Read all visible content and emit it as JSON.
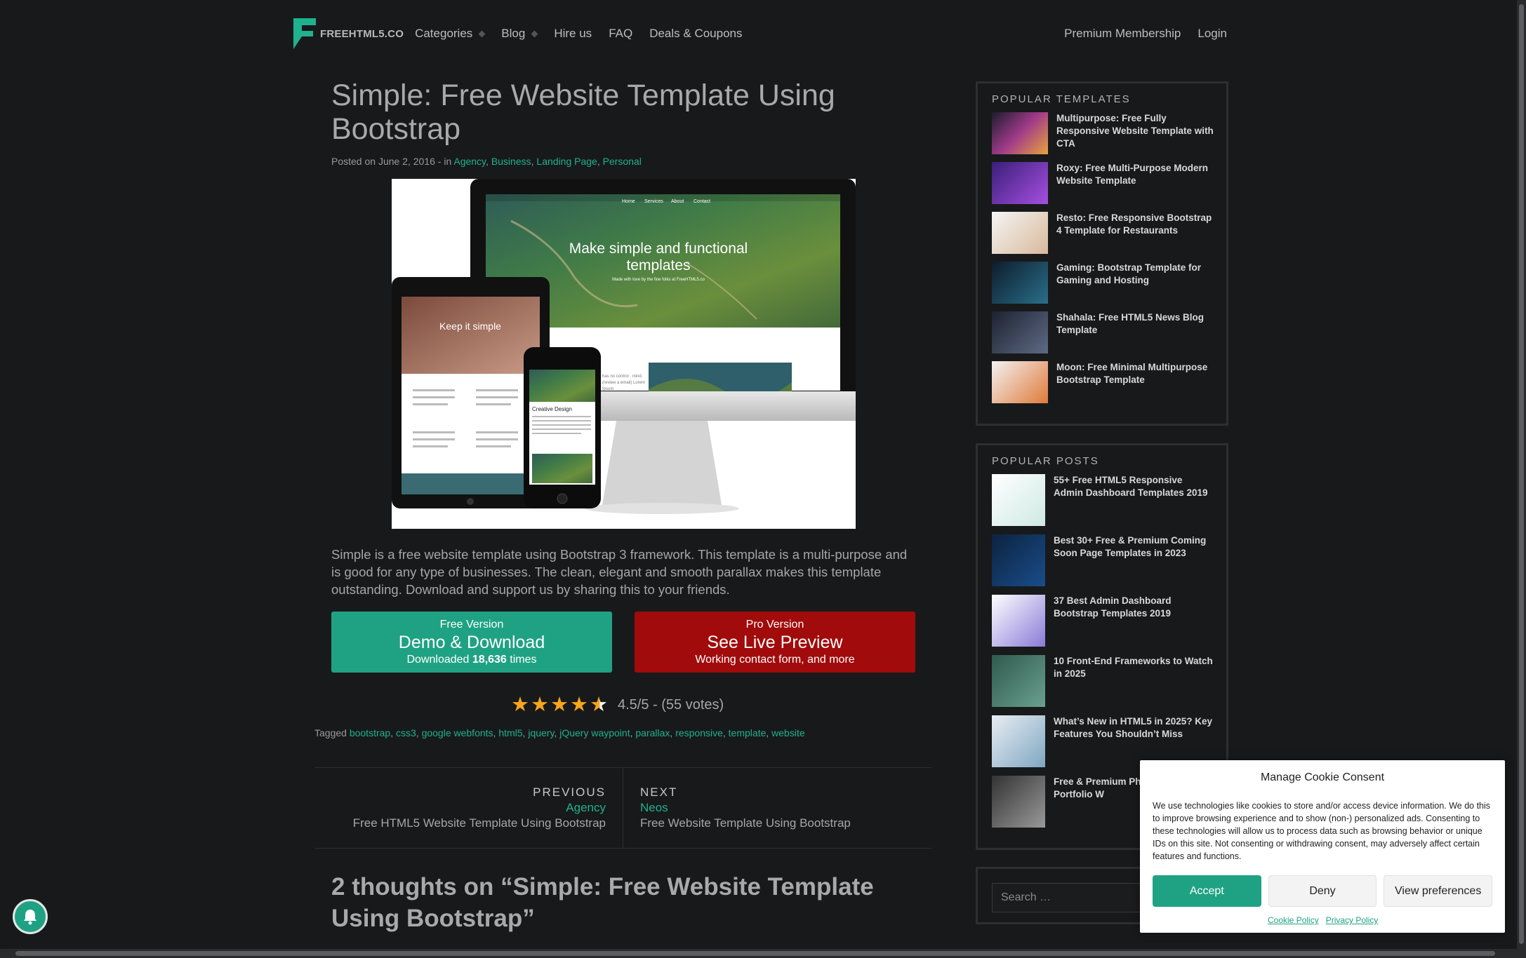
{
  "header": {
    "logo": "FREEHTML5.CO",
    "nav": [
      "Categories",
      "Blog",
      "Hire us",
      "FAQ",
      "Deals & Coupons"
    ],
    "nav_right": [
      "Premium Membership",
      "Login"
    ]
  },
  "post": {
    "title": "Simple: Free Website Template Using Bootstrap",
    "posted": "Posted on June 2, 2016 - in",
    "categories": [
      "Agency",
      "Business",
      "Landing Page",
      "Personal"
    ],
    "hero": {
      "desktop_nav": [
        "Home",
        "Services",
        "About",
        "Contact"
      ],
      "desktop_heading": "Make simple and functional templates",
      "desktop_sub": "Made with love by the fine folks at FreeHTML5.co",
      "tablet_heading": "Keep it simple",
      "phone_heading": "Creative Design",
      "desktop_side_text": "has no control . mind. (review a email) Lorem Ipsum"
    },
    "description": "Simple is a free website template using Bootstrap 3 framework. This template is a multi-purpose and is good for any type of businesses. The clean, elegant and smooth parallax makes this template outstanding. Download and support us by sharing this to your friends.",
    "free_btn": {
      "small": "Free Version",
      "big": "Demo & Download",
      "sub_prefix": "Downloaded",
      "count": "18,636",
      "sub_suffix": "times"
    },
    "pro_btn": {
      "small": "Pro Version",
      "big": "See Live Preview",
      "sub": "Working contact form, and more"
    },
    "rating": {
      "value": 4.5,
      "text": "4.5/5 - (55 votes)"
    },
    "tags_label": "Tagged",
    "tags": [
      "bootstrap",
      "css3",
      "google webfonts",
      "html5",
      "jquery",
      "jQuery waypoint",
      "parallax",
      "responsive",
      "template",
      "website"
    ],
    "prev": {
      "label": "PREVIOUS",
      "name": "Agency",
      "desc": "Free HTML5 Website Template Using Bootstrap"
    },
    "next": {
      "label": "NEXT",
      "name": "Neos",
      "desc": "Free Website Template Using Bootstrap"
    },
    "comments_title": "2 thoughts on “Simple: Free Website Template Using Bootstrap”"
  },
  "sidebar": {
    "popular_templates": {
      "title": "POPULAR TEMPLATES",
      "items": [
        "Multipurpose: Free Fully Responsive Website Template with CTA",
        "Roxy: Free Multi-Purpose Modern Website Template",
        "Resto: Free Responsive Bootstrap 4 Template for Restaurants",
        "Gaming: Bootstrap Template for Gaming and Hosting",
        "Shahala: Free HTML5 News Blog Template",
        "Moon: Free Minimal Multipurpose Bootstrap Template"
      ]
    },
    "popular_posts": {
      "title": "POPULAR POSTS",
      "items": [
        "55+ Free HTML5 Responsive Admin Dashboard Templates 2019",
        "Best 30+ Free & Premium Coming Soon Page Templates in 2023",
        "37 Best Admin Dashboard Bootstrap Templates 2019",
        "10 Front-End Frameworks to Watch in 2025",
        "What’s New in HTML5 in 2025? Key Features You Shouldn’t Miss",
        "Free & Premium Ph Creative Portfolio W"
      ]
    },
    "search_placeholder": "Search …"
  },
  "cookie": {
    "title": "Manage Cookie Consent",
    "text": "We use technologies like cookies to store and/or access device information. We do this to improve browsing experience and to show (non-) personalized ads. Consenting to these technologies will allow us to process data such as browsing behavior or unique IDs on this site. Not consenting or withdrawing consent, may adversely affect certain features and functions.",
    "accept": "Accept",
    "deny": "Deny",
    "preferences": "View preferences",
    "links": [
      "Cookie Policy",
      "Privacy Policy"
    ]
  },
  "colors": {
    "background": "#18191b",
    "accent": "#1fb28f",
    "free_button": "#1fa283",
    "pro_button": "#a10b0b",
    "star": "#f7a51b"
  }
}
